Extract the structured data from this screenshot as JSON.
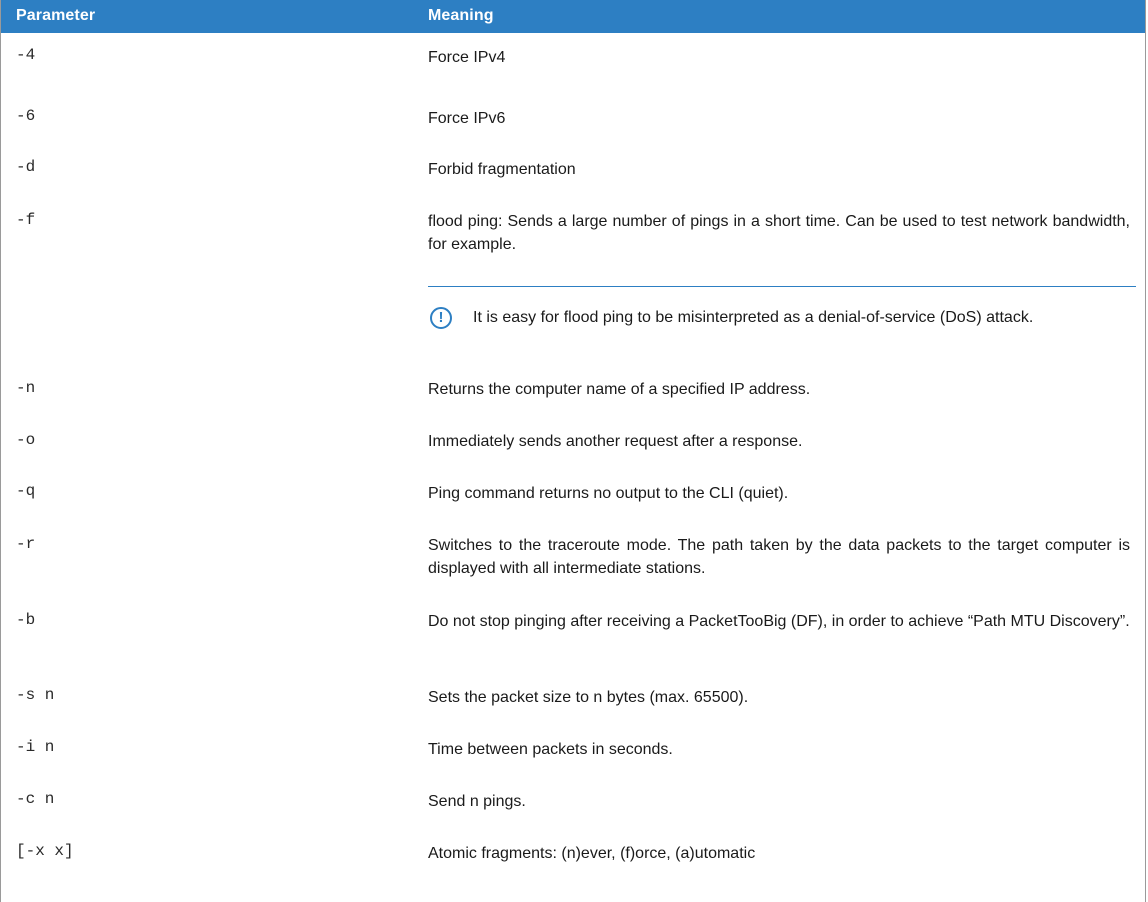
{
  "header": {
    "col_parameter": "Parameter",
    "col_meaning": "Meaning"
  },
  "rows": [
    {
      "param": "-4",
      "meaning": "Force IPv4"
    },
    {
      "param": "-6",
      "meaning": "Force IPv6"
    },
    {
      "param": "-d",
      "meaning": "Forbid fragmentation"
    },
    {
      "param": "-f",
      "meaning": "flood ping: Sends a large number of pings in a short time. Can be used to test network bandwidth, for example."
    },
    {
      "param": "-n",
      "meaning": "Returns the computer name of a specified IP address."
    },
    {
      "param": "-o",
      "meaning": "Immediately sends another request after a response."
    },
    {
      "param": "-q",
      "meaning": "Ping command returns no output to the CLI (quiet)."
    },
    {
      "param": "-r",
      "meaning": "Switches to the traceroute mode. The path taken by the data packets to the target computer is displayed with all intermediate stations."
    },
    {
      "param": "-b",
      "meaning": "Do not stop pinging after receiving a PacketTooBig (DF), in order to achieve “Path MTU Discovery”."
    },
    {
      "param": "-s n",
      "meaning": "Sets the packet size to n bytes (max. 65500)."
    },
    {
      "param": "-i n",
      "meaning": "Time between packets in seconds."
    },
    {
      "param": "-c n",
      "meaning": "Send n pings."
    },
    {
      "param": "[-x x]",
      "meaning": "Atomic fragments: (n)ever, (f)orce, (a)utomatic"
    }
  ],
  "note": {
    "icon": "exclamation-circle-icon",
    "glyph": "!",
    "text": "It is easy for flood ping to be misinterpreted as a denial-of-service (DoS) attack."
  },
  "colors": {
    "header_bg": "#2d7fc3",
    "accent": "#2d7fc3"
  }
}
